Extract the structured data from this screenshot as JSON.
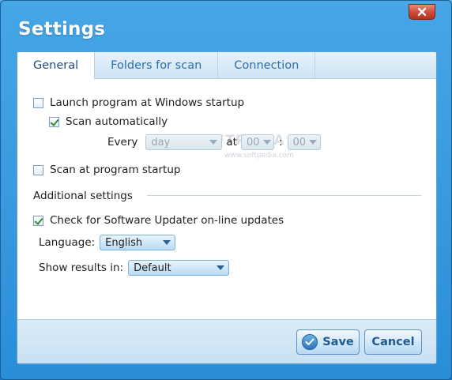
{
  "window": {
    "title": "Settings"
  },
  "tabs": [
    {
      "label": "General",
      "active": true
    },
    {
      "label": "Folders for scan",
      "active": false
    },
    {
      "label": "Connection",
      "active": false
    }
  ],
  "general": {
    "launch_startup": {
      "label": "Launch program at Windows startup",
      "checked": false
    },
    "scan_auto": {
      "label": "Scan automatically",
      "checked": true
    },
    "every": {
      "label": "Every",
      "period_value": "day",
      "at_label": "at",
      "hour_value": "00",
      "separator": ":",
      "minute_value": "00",
      "enabled": false
    },
    "scan_program_startup": {
      "label": "Scan at program startup",
      "checked": false
    }
  },
  "additional": {
    "heading": "Additional settings",
    "check_updates": {
      "label": "Check for Software Updater on-line updates",
      "checked": true
    },
    "language": {
      "label": "Language:",
      "value": "English"
    },
    "show_results": {
      "label": "Show results in:",
      "value": "Default"
    }
  },
  "footer": {
    "save_label": "Save",
    "cancel_label": "Cancel"
  },
  "watermark": {
    "text": "SOFTPEDIA",
    "sub": "www.softpedia.com"
  },
  "icons": {
    "close": "close-icon",
    "save": "checkmark-icon"
  },
  "colors": {
    "window_blue": "#2a8ed8",
    "accent_text": "#1d5a8f",
    "close_red": "#c94b35",
    "check_green": "#2f8a3a"
  }
}
